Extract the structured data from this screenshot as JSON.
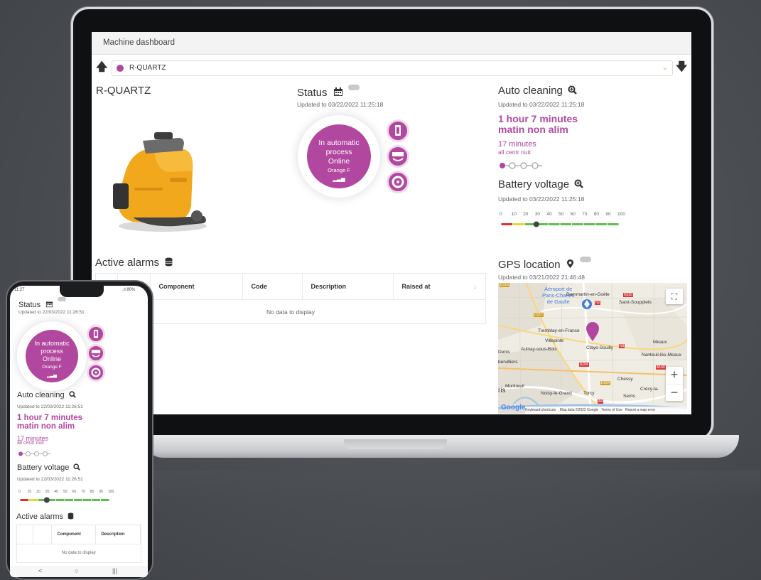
{
  "dashboard": {
    "title": "Machine dashboard",
    "machine_select": "R-QUARTZ",
    "machine_name": "R-QUARTZ"
  },
  "status": {
    "title": "Status",
    "updated": "Updated to 03/22/2022 11:25:18",
    "line1": "In automatic",
    "line2": "process",
    "line3": "Online",
    "network": "Orange F"
  },
  "auto_cleaning": {
    "title": "Auto cleaning",
    "updated": "Updated to 03/22/2022 11:25:18",
    "duration": "1 hour 7 minutes",
    "program": "matin non alim",
    "duration2": "17 minutes",
    "program2": "all centr nuit"
  },
  "battery": {
    "title": "Battery voltage",
    "updated": "Updated to 03/22/2022 11:25:18",
    "scale": [
      "0",
      "10",
      "20",
      "30",
      "40",
      "50",
      "60",
      "70",
      "80",
      "90",
      "100"
    ],
    "level_percent": 30
  },
  "alarms": {
    "title": "Active alarms",
    "columns": [
      "Component",
      "Code",
      "Description",
      "Raised at"
    ],
    "empty": "No data to display"
  },
  "gps": {
    "title": "GPS location",
    "updated": "Updated to 03/21/2022 21:46:48",
    "places": [
      "Aéroport de",
      "Paris-Charles",
      "de Gaulle",
      "Dammartin-en-Goële",
      "Saint-Soupplets",
      "Tremblay-en-France",
      "Villepinte",
      "Claye-Souilly",
      "Meaux",
      "Aulnay-sous-Bois",
      "Denis",
      "Nanteuil-lès-Meaux",
      "bervilliers",
      "Chessy",
      "Montreuil",
      "Noisy-le-Grand",
      "Torcy",
      "Serris",
      "Crécy-la-",
      "ris"
    ],
    "roads": [
      "D316",
      "D317",
      "N330",
      "N2",
      "N3",
      "A104",
      "D934",
      "A4",
      "A140"
    ],
    "footer": [
      "Keyboard shortcuts",
      "Map data ©2022 Google",
      "Terms of Use",
      "Report a map error"
    ],
    "google": "Google",
    "zoom_in": "+",
    "zoom_out": "−",
    "fullscreen": "⛶"
  },
  "phone": {
    "statusbar_time": "11:27",
    "statusbar_right": ".ıl 80%",
    "status_title": "Status",
    "status_updated": "Updated to 22/03/2022 11:26:51",
    "auto_title": "Auto cleaning",
    "auto_updated": "Updated to 22/03/2022 11:26:51",
    "battery_title": "Battery voltage",
    "battery_updated": "Updated to 22/03/2022 11:26:51",
    "alarms_title": "Active alarms",
    "alarms_columns": [
      "Component",
      "Description"
    ],
    "alarms_empty": "No data to display",
    "nav": [
      "<",
      "○",
      "|||"
    ]
  },
  "colors": {
    "accent": "#b2479f",
    "battery_red": "#e03131",
    "battery_yellow": "#f2d230",
    "battery_green": "#5dc04a"
  }
}
